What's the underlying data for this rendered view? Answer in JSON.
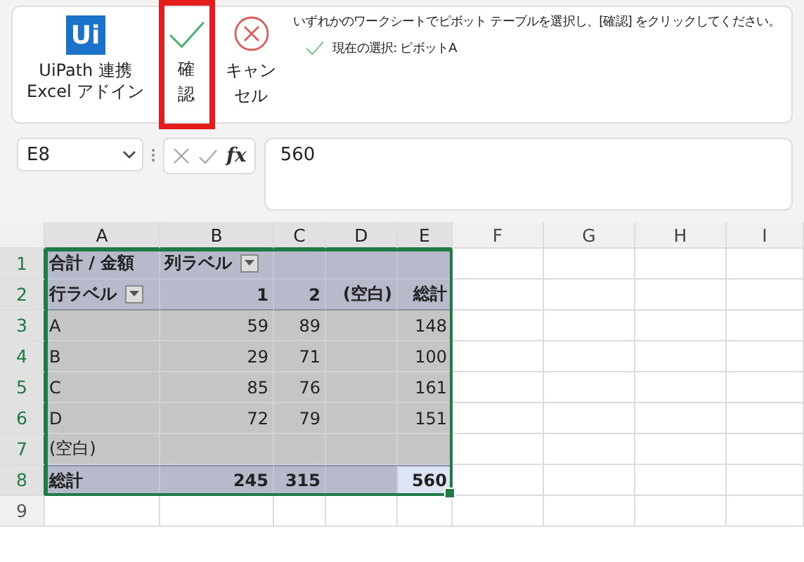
{
  "ribbon": {
    "addin": {
      "logo": "Ui",
      "label_lines": [
        "UiPath 連携",
        "Excel アドイン"
      ]
    },
    "buttons": [
      {
        "kind": "confirm",
        "label_lines": [
          "確",
          "認"
        ],
        "highlighted": true
      },
      {
        "kind": "cancel",
        "label_lines": [
          "キャン",
          "セル"
        ],
        "highlighted": false
      }
    ],
    "message": "いずれかのワークシートでピボット テーブルを選択し、[確認] をクリックしてください。",
    "status": "現在の選択: ピボットA"
  },
  "formula_bar": {
    "name_box": "E8",
    "fx": "fx",
    "value": "560"
  },
  "grid": {
    "columns": [
      {
        "label": "A",
        "highlighted": true
      },
      {
        "label": "B",
        "highlighted": true
      },
      {
        "label": "C",
        "highlighted": true
      },
      {
        "label": "D",
        "highlighted": true
      },
      {
        "label": "E",
        "highlighted": true
      },
      {
        "label": "F",
        "highlighted": false
      },
      {
        "label": "G",
        "highlighted": false
      },
      {
        "label": "H",
        "highlighted": false
      },
      {
        "label": "I",
        "highlighted": false
      }
    ],
    "rows": [
      {
        "number": "1",
        "highlighted": true,
        "kind": "header",
        "cells": [
          {
            "kind": "text",
            "text": "合計 / 金額",
            "selected": false
          },
          {
            "kind": "filter",
            "text": "列ラベル",
            "selected": false
          },
          {
            "kind": "text",
            "text": "",
            "selected": false
          },
          {
            "kind": "text",
            "text": "",
            "selected": false
          },
          {
            "kind": "text",
            "text": "",
            "selected": false
          }
        ]
      },
      {
        "number": "2",
        "highlighted": true,
        "kind": "header",
        "cells": [
          {
            "kind": "filter",
            "text": "行ラベル",
            "selected": false
          },
          {
            "kind": "text",
            "text": "1",
            "selected": false
          },
          {
            "kind": "text",
            "text": "2",
            "selected": false
          },
          {
            "kind": "text",
            "text": "(空白)",
            "selected": false
          },
          {
            "kind": "text",
            "text": "総計",
            "selected": false
          }
        ]
      },
      {
        "number": "3",
        "highlighted": true,
        "kind": "body",
        "cells": [
          {
            "kind": "text",
            "text": "A",
            "selected": false
          },
          {
            "kind": "text",
            "text": "59",
            "selected": false
          },
          {
            "kind": "text",
            "text": "89",
            "selected": false
          },
          {
            "kind": "text",
            "text": "",
            "selected": false
          },
          {
            "kind": "text",
            "text": "148",
            "selected": false
          }
        ]
      },
      {
        "number": "4",
        "highlighted": true,
        "kind": "body",
        "cells": [
          {
            "kind": "text",
            "text": "B",
            "selected": false
          },
          {
            "kind": "text",
            "text": "29",
            "selected": false
          },
          {
            "kind": "text",
            "text": "71",
            "selected": false
          },
          {
            "kind": "text",
            "text": "",
            "selected": false
          },
          {
            "kind": "text",
            "text": "100",
            "selected": false
          }
        ]
      },
      {
        "number": "5",
        "highlighted": true,
        "kind": "body",
        "cells": [
          {
            "kind": "text",
            "text": "C",
            "selected": false
          },
          {
            "kind": "text",
            "text": "85",
            "selected": false
          },
          {
            "kind": "text",
            "text": "76",
            "selected": false
          },
          {
            "kind": "text",
            "text": "",
            "selected": false
          },
          {
            "kind": "text",
            "text": "161",
            "selected": false
          }
        ]
      },
      {
        "number": "6",
        "highlighted": true,
        "kind": "body",
        "cells": [
          {
            "kind": "text",
            "text": "D",
            "selected": false
          },
          {
            "kind": "text",
            "text": "72",
            "selected": false
          },
          {
            "kind": "text",
            "text": "79",
            "selected": false
          },
          {
            "kind": "text",
            "text": "",
            "selected": false
          },
          {
            "kind": "text",
            "text": "151",
            "selected": false
          }
        ]
      },
      {
        "number": "7",
        "highlighted": true,
        "kind": "body",
        "cells": [
          {
            "kind": "text",
            "text": "(空白)",
            "selected": false
          },
          {
            "kind": "text",
            "text": "",
            "selected": false
          },
          {
            "kind": "text",
            "text": "",
            "selected": false
          },
          {
            "kind": "text",
            "text": "",
            "selected": false
          },
          {
            "kind": "text",
            "text": "",
            "selected": false
          }
        ]
      },
      {
        "number": "8",
        "highlighted": true,
        "kind": "total",
        "cells": [
          {
            "kind": "text",
            "text": "総計",
            "selected": false
          },
          {
            "kind": "text",
            "text": "245",
            "selected": false
          },
          {
            "kind": "text",
            "text": "315",
            "selected": false
          },
          {
            "kind": "text",
            "text": "",
            "selected": false
          },
          {
            "kind": "text",
            "text": "560",
            "selected": true
          }
        ]
      },
      {
        "number": "9",
        "highlighted": false,
        "kind": "empty",
        "cells": []
      }
    ]
  }
}
